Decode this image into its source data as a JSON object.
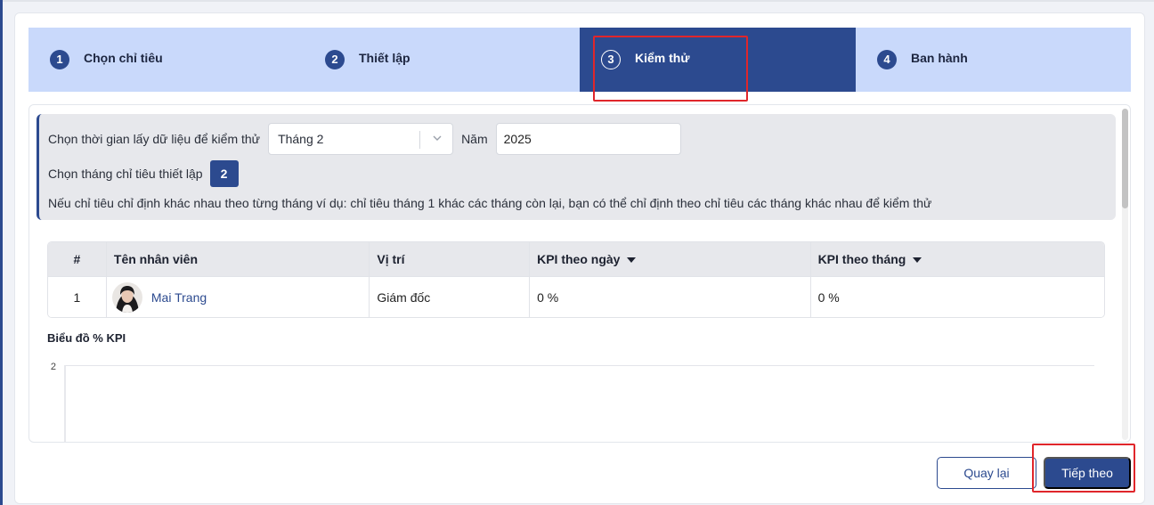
{
  "stepper": {
    "steps": [
      {
        "num": "1",
        "label": "Chọn chỉ tiêu"
      },
      {
        "num": "2",
        "label": "Thiết lập"
      },
      {
        "num": "3",
        "label": "Kiểm thử"
      },
      {
        "num": "4",
        "label": "Ban hành"
      }
    ],
    "active_step": 3
  },
  "filters": {
    "time_label": "Chọn thời gian lấy dữ liệu để kiểm thử",
    "month_value": "Tháng 2",
    "year_label": "Năm",
    "year_value": "2025",
    "target_month_label": "Chọn tháng chỉ tiêu thiết lập",
    "target_month_value": "2",
    "note": "Nếu chỉ tiêu chỉ định khác nhau theo từng tháng ví dụ: chỉ tiêu tháng 1 khác các tháng còn lại, bạn có thể chỉ định theo chỉ tiêu các tháng khác nhau để kiểm thử"
  },
  "table": {
    "headers": [
      "#",
      "Tên nhân viên",
      "Vị trí",
      "KPI theo ngày",
      "KPI theo tháng"
    ],
    "rows": [
      {
        "idx": "1",
        "name": "Mai Trang",
        "position": "Giám đốc",
        "kpi_day": "0 %",
        "kpi_month": "0 %"
      }
    ]
  },
  "chart": {
    "title": "Biểu đồ % KPI",
    "y_tick_top": "2"
  },
  "actions": {
    "back_label": "Quay lại",
    "next_label": "Tiếp theo"
  },
  "colors": {
    "primary": "#2c4a8f",
    "stepper_bg": "#c9d9fb",
    "highlight": "#e0262b"
  }
}
